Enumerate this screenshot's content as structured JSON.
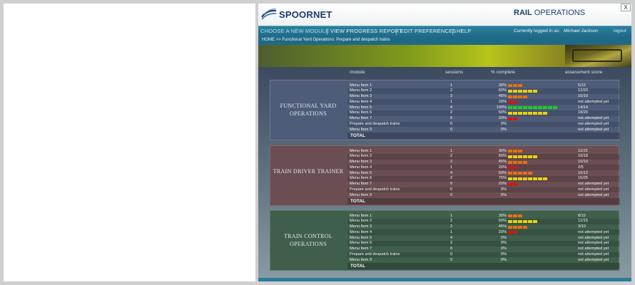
{
  "header": {
    "logo_text": "SPOORNET",
    "title_bold": "RAIL",
    "title_rest": " OPERATIONS",
    "close_label": "X"
  },
  "nav": {
    "items": [
      {
        "label": "CHOOSE A NEW MODULE"
      },
      {
        "label": "VIEW PROGRESS REPORT"
      },
      {
        "label": "EDIT PREFERENCES"
      },
      {
        "label": "HELP"
      }
    ],
    "logged_in_label": "Currently logged in as:",
    "user_name": "Michael Jackson",
    "logout_label": "logout"
  },
  "breadcrumb": {
    "text": "HOME  >>  Functional Yard Operations:  Prepare and despatch trains"
  },
  "columns": {
    "module": "module",
    "sessions": "sessions",
    "percent": "% complete",
    "score": "assessment score"
  },
  "colors": {
    "bar_orange": "#e8700e",
    "bar_yellow": "#e8d20c",
    "bar_green": "#22cc22",
    "bar_red": "#dd1111"
  },
  "sections": [
    {
      "title_line1": "FUNCTIONAL YARD",
      "title_line2": "OPERATIONS",
      "theme": "blue",
      "total_label": "TOTAL",
      "rows": [
        {
          "module": "Menu Item 1",
          "sessions": "1",
          "percent": "30%",
          "score": "5/12",
          "bar_count": 3,
          "bar_color": "orange"
        },
        {
          "module": "Menu Item 2",
          "sessions": "2",
          "percent": "60%",
          "score": "12/20",
          "bar_count": 6,
          "bar_color": "yellow"
        },
        {
          "module": "Menu Item 3",
          "sessions": "3",
          "percent": "45%",
          "score": "10/10",
          "bar_count": 4,
          "bar_color": "orange"
        },
        {
          "module": "Menu Item 4",
          "sessions": "1",
          "percent": "20%",
          "score": "not attempted yet",
          "bar_count": 2,
          "bar_color": "red"
        },
        {
          "module": "Menu Item 5",
          "sessions": "4",
          "percent": "100%",
          "score": "14/14",
          "bar_count": 10,
          "bar_color": "green"
        },
        {
          "module": "Menu Item 6",
          "sessions": "2",
          "percent": "60%",
          "score": "18/20",
          "bar_count": 8,
          "bar_color": "yellow"
        },
        {
          "module": "Menu Item 7",
          "sessions": "0",
          "percent": "20%",
          "score": "not attempted yet",
          "bar_count": 2,
          "bar_color": "red"
        },
        {
          "module": "Prepare and despatch trains",
          "sessions": "0",
          "percent": "0%",
          "score": "not attempted yet",
          "bar_count": 0,
          "bar_color": "red"
        },
        {
          "module": "Menu Item 9",
          "sessions": "0",
          "percent": "0%",
          "score": "not attempted yet",
          "bar_count": 0,
          "bar_color": "red"
        }
      ]
    },
    {
      "title_line1": "TRAIN DRIVER TRAINER",
      "title_line2": "",
      "theme": "red",
      "total_label": "TOTAL",
      "rows": [
        {
          "module": "Menu Item 1",
          "sessions": "1",
          "percent": "30%",
          "score": "11/15",
          "bar_count": 3,
          "bar_color": "orange"
        },
        {
          "module": "Menu Item 2",
          "sessions": "2",
          "percent": "60%",
          "score": "16/18",
          "bar_count": 6,
          "bar_color": "yellow"
        },
        {
          "module": "Menu Item 3",
          "sessions": "2",
          "percent": "45%",
          "score": "10/10",
          "bar_count": 4,
          "bar_color": "orange"
        },
        {
          "module": "Menu Item 4",
          "sessions": "1",
          "percent": "20%",
          "score": "2/5",
          "bar_count": 2,
          "bar_color": "red"
        },
        {
          "module": "Menu Item 5",
          "sessions": "4",
          "percent": "50%",
          "score": "10/12",
          "bar_count": 5,
          "bar_color": "orange"
        },
        {
          "module": "Menu Item 6",
          "sessions": "2",
          "percent": "75%",
          "score": "16/25",
          "bar_count": 8,
          "bar_color": "yellow"
        },
        {
          "module": "Menu Item 7",
          "sessions": "0",
          "percent": "20%",
          "score": "not attempted yet",
          "bar_count": 2,
          "bar_color": "red"
        },
        {
          "module": "Prepare and despatch trains",
          "sessions": "0",
          "percent": "0%",
          "score": "not attempted yet",
          "bar_count": 0,
          "bar_color": "red"
        },
        {
          "module": "Menu Item 9",
          "sessions": "0",
          "percent": "0%",
          "score": "not attempted yet",
          "bar_count": 0,
          "bar_color": "red"
        }
      ]
    },
    {
      "title_line1": "TRAIN CONTROL",
      "title_line2": "OPERATIONS",
      "theme": "green",
      "total_label": "TOTAL",
      "rows": [
        {
          "module": "Menu Item 1",
          "sessions": "1",
          "percent": "30%",
          "score": "8/10",
          "bar_count": 3,
          "bar_color": "orange"
        },
        {
          "module": "Menu Item 2",
          "sessions": "2",
          "percent": "60%",
          "score": "12/15",
          "bar_count": 6,
          "bar_color": "yellow"
        },
        {
          "module": "Menu Item 3",
          "sessions": "2",
          "percent": "45%",
          "score": "3/10",
          "bar_count": 4,
          "bar_color": "orange"
        },
        {
          "module": "Menu Item 4",
          "sessions": "1",
          "percent": "20%",
          "score": "not attempted yet",
          "bar_count": 2,
          "bar_color": "red"
        },
        {
          "module": "Menu Item 5",
          "sessions": "4",
          "percent": "0%",
          "score": "not attempted yet",
          "bar_count": 0,
          "bar_color": "red"
        },
        {
          "module": "Menu Item 6",
          "sessions": "2",
          "percent": "0%",
          "score": "not attempted yet",
          "bar_count": 0,
          "bar_color": "red"
        },
        {
          "module": "Menu Item 7",
          "sessions": "0",
          "percent": "0%",
          "score": "not attempted yet",
          "bar_count": 0,
          "bar_color": "red"
        },
        {
          "module": "Prepare and despatch trains",
          "sessions": "0",
          "percent": "0%",
          "score": "not attempted yet",
          "bar_count": 0,
          "bar_color": "red"
        },
        {
          "module": "Menu Item 9",
          "sessions": "0",
          "percent": "0%",
          "score": "not attempted yet",
          "bar_count": 0,
          "bar_color": "red"
        }
      ]
    }
  ]
}
